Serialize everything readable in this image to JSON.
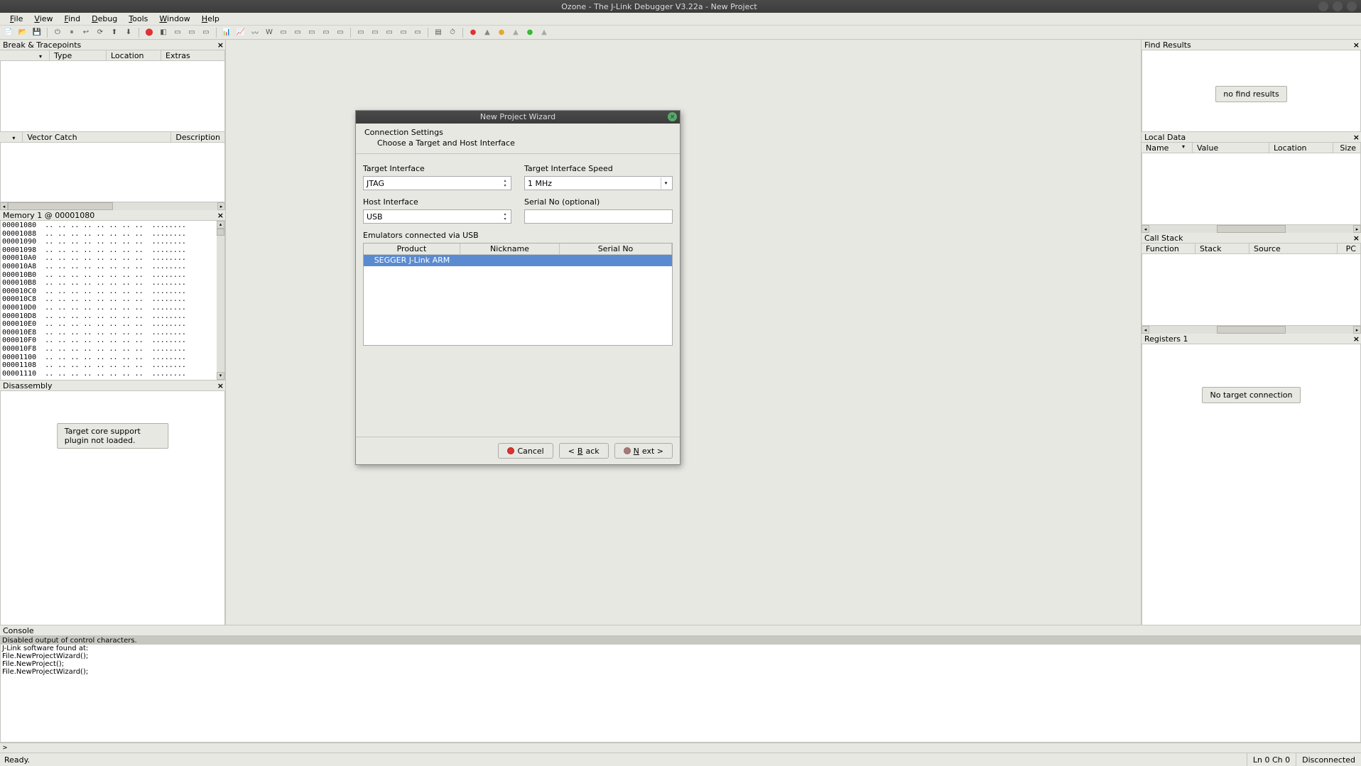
{
  "title": "Ozone - The J-Link Debugger V3.22a - New Project",
  "menu": [
    "File",
    "View",
    "Find",
    "Debug",
    "Tools",
    "Window",
    "Help"
  ],
  "panels": {
    "breakpoints": {
      "title": "Break & Tracepoints",
      "cols": [
        "",
        "Type",
        "Location",
        "Extras"
      ]
    },
    "vectorcatch": {
      "title": "Vector Catch",
      "cols": [
        "",
        "Vector Catch",
        "Description"
      ]
    },
    "memory": {
      "title": "Memory 1 @ 00001080",
      "addrs": [
        "00001080",
        "00001088",
        "00001090",
        "00001098",
        "000010A0",
        "000010A8",
        "000010B0",
        "000010B8",
        "000010C0",
        "000010C8",
        "000010D0",
        "000010D8",
        "000010E0",
        "000010E8",
        "000010F0",
        "000010F8",
        "00001100",
        "00001108",
        "00001110"
      ],
      "hex": ".. .. .. .. .. .. .. ..",
      "ascii": "........"
    },
    "disassembly": {
      "title": "Disassembly",
      "msg": "Target core support plugin not loaded."
    },
    "console": {
      "title": "Console",
      "greyline": "Disabled output of control characters.",
      "lines": [
        "J-Link software found at:",
        "File.NewProjectWizard();",
        "File.NewProject();",
        "File.NewProjectWizard();"
      ],
      "prompt": ">"
    },
    "findresults": {
      "title": "Find Results",
      "msg": "no find results"
    },
    "localdata": {
      "title": "Local Data",
      "cols": [
        "Name",
        "Value",
        "Location",
        "Size"
      ]
    },
    "callstack": {
      "title": "Call Stack",
      "cols": [
        "Function",
        "Stack Frame",
        "Source",
        "PC"
      ]
    },
    "registers": {
      "title": "Registers 1",
      "msg": "No target connection"
    }
  },
  "dialog": {
    "title": "New Project Wizard",
    "header": "Connection Settings",
    "sub": "Choose a Target and Host Interface",
    "target_if_label": "Target Interface",
    "target_if_value": "JTAG",
    "target_speed_label": "Target Interface Speed",
    "target_speed_value": "1 MHz",
    "host_if_label": "Host Interface",
    "host_if_value": "USB",
    "serial_label": "Serial No (optional)",
    "serial_value": "",
    "emu_label": "Emulators connected via USB",
    "emu_cols": [
      "Product",
      "Nickname",
      "Serial No"
    ],
    "emu_row": [
      "SEGGER J-Link ARM",
      "",
      ""
    ],
    "buttons": {
      "cancel": "Cancel",
      "back": "< Back",
      "next": "Next >"
    }
  },
  "status": {
    "ready": "Ready.",
    "lncol": "Ln 0  Ch 0",
    "conn": "Disconnected"
  }
}
